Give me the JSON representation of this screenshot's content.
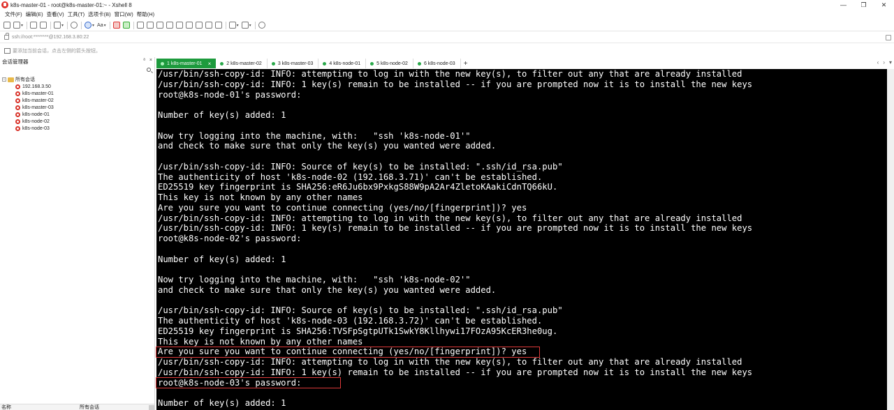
{
  "window": {
    "title": "k8s-master-01 - root@k8s-master-01:~ - Xshell 8",
    "controls": [
      "—",
      "❐",
      "✕"
    ]
  },
  "menu": [
    "文件(F)",
    "编辑(E)",
    "查看(V)",
    "工具(T)",
    "选项卡(B)",
    "窗口(W)",
    "帮助(H)"
  ],
  "toolbar": {
    "font_label": "Aa"
  },
  "address": {
    "url": "ssh://root:********@192.168.3.80:22"
  },
  "hint": {
    "text": "要添加当前会话，点击左侧的箭头按钮。"
  },
  "sidebar": {
    "title": "会话管理器",
    "pin": "ᵃ",
    "close": "×",
    "root_label": "所有会话",
    "sessions": [
      "192.168.3.50",
      "k8s-master-01",
      "k8s-master-02",
      "k8s-master-03",
      "k8s-node-01",
      "k8s-node-02",
      "k8s-node-03"
    ],
    "footer": {
      "col_name": "名称",
      "col_value": "所有会话"
    }
  },
  "tabs": [
    {
      "label": "1 k8s-master-01",
      "active": true
    },
    {
      "label": "2 k8s-master-02",
      "active": false
    },
    {
      "label": "3 k8s-master-03",
      "active": false
    },
    {
      "label": "4 k8s-node-01",
      "active": false
    },
    {
      "label": "5 k8s-node-02",
      "active": false
    },
    {
      "label": "6 k8s-node-03",
      "active": false
    }
  ],
  "tab_add": "+",
  "tab_nav": [
    "‹",
    "›",
    "▾"
  ],
  "terminal": {
    "lines": [
      "/usr/bin/ssh-copy-id: INFO: attempting to log in with the new key(s), to filter out any that are already installed",
      "/usr/bin/ssh-copy-id: INFO: 1 key(s) remain to be installed -- if you are prompted now it is to install the new keys",
      "root@k8s-node-01's password:",
      "",
      "Number of key(s) added: 1",
      "",
      "Now try logging into the machine, with:   \"ssh 'k8s-node-01'\"",
      "and check to make sure that only the key(s) you wanted were added.",
      "",
      "/usr/bin/ssh-copy-id: INFO: Source of key(s) to be installed: \".ssh/id_rsa.pub\"",
      "The authenticity of host 'k8s-node-02 (192.168.3.71)' can't be established.",
      "ED25519 key fingerprint is SHA256:eR6Ju6bx9PxkgS88W9pA2Ar4ZletoKAakiCdnTQ66kU.",
      "This key is not known by any other names",
      "Are you sure you want to continue connecting (yes/no/[fingerprint])? yes",
      "/usr/bin/ssh-copy-id: INFO: attempting to log in with the new key(s), to filter out any that are already installed",
      "/usr/bin/ssh-copy-id: INFO: 1 key(s) remain to be installed -- if you are prompted now it is to install the new keys",
      "root@k8s-node-02's password:",
      "",
      "Number of key(s) added: 1",
      "",
      "Now try logging into the machine, with:   \"ssh 'k8s-node-02'\"",
      "and check to make sure that only the key(s) you wanted were added.",
      "",
      "/usr/bin/ssh-copy-id: INFO: Source of key(s) to be installed: \".ssh/id_rsa.pub\"",
      "The authenticity of host 'k8s-node-03 (192.168.3.72)' can't be established.",
      "ED25519 key fingerprint is SHA256:TVSFpSgtpUTk1SwkY8Kllhywi17FOzA95KcER3he0ug.",
      "This key is not known by any other names",
      "Are you sure you want to continue connecting (yes/no/[fingerprint])? yes",
      "/usr/bin/ssh-copy-id: INFO: attempting to log in with the new key(s), to filter out any that are already installed",
      "/usr/bin/ssh-copy-id: INFO: 1 key(s) remain to be installed -- if you are prompted now it is to install the new keys",
      "root@k8s-node-03's password:",
      "",
      "Number of key(s) added: 1"
    ]
  },
  "colors": {
    "accent_tab": "#1d9a3d",
    "terminal_bg": "#000000",
    "terminal_fg": "#ffffff",
    "highlight": "#e03a3a"
  }
}
